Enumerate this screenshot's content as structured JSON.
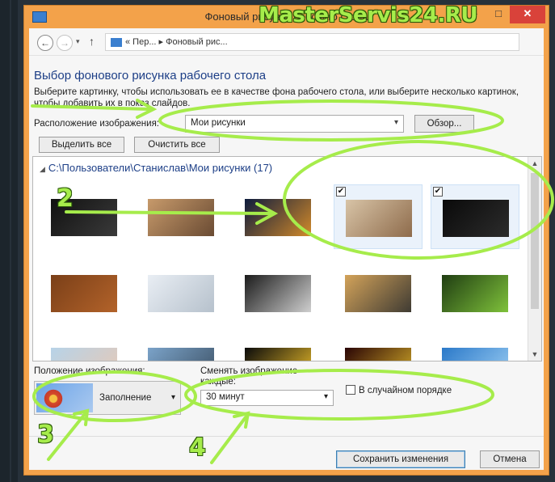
{
  "window": {
    "title": "Фоновый рисунок рабочего стола",
    "minimize_glyph": "–",
    "maximize_glyph": "□",
    "close_glyph": "✕"
  },
  "address": {
    "back_glyph": "←",
    "forward_glyph": "→",
    "up_glyph": "↑",
    "recent_glyph": "▾",
    "breadcrumb": "« Пер... ▸ Фоновый рис...",
    "search_icon": "search-icon"
  },
  "watermark": "MasterServis24.RU",
  "page": {
    "heading": "Выбор фонового рисунка рабочего стола",
    "description": "Выберите картинку, чтобы использовать ее в качестве фона рабочего стола, или выберите несколько картинок, чтобы добавить их в показ слайдов."
  },
  "location": {
    "label": "Расположение изображения:",
    "value": "Мои рисунки",
    "browse": "Обзор..."
  },
  "selection": {
    "select_all": "Выделить все",
    "clear_all": "Очистить все"
  },
  "gallery": {
    "folder": "C:\\Пользователи\\Станислав\\Мои рисунки (17)",
    "thumbs": [
      {
        "name": "dark-texture",
        "colors": [
          "#111",
          "#3a3a3a"
        ],
        "checked": false
      },
      {
        "name": "girl-car-interior",
        "colors": [
          "#c79a6b",
          "#6a4b33"
        ],
        "checked": false
      },
      {
        "name": "night-city",
        "colors": [
          "#0d1b3d",
          "#d28a2a"
        ],
        "checked": false
      },
      {
        "name": "vintage-camera-desk",
        "colors": [
          "#d8c4a7",
          "#8e6b4b"
        ],
        "checked": true
      },
      {
        "name": "dark-floral",
        "colors": [
          "#0a0a0a",
          "#2c2c2c"
        ],
        "checked": true
      },
      {
        "name": "wood-shelves",
        "colors": [
          "#7a3f18",
          "#b3632a"
        ],
        "checked": false
      },
      {
        "name": "white-car-girl",
        "colors": [
          "#e9eef4",
          "#b6c1cc"
        ],
        "checked": false
      },
      {
        "name": "girl-dark",
        "colors": [
          "#1b1b1b",
          "#cfcfcf"
        ],
        "checked": false
      },
      {
        "name": "white-car-sunset",
        "colors": [
          "#d3a35a",
          "#3f3b33"
        ],
        "checked": false
      },
      {
        "name": "green-grass",
        "colors": [
          "#1f3d12",
          "#7fc23b"
        ],
        "checked": false
      },
      {
        "name": "pastel-stripes",
        "colors": [
          "#b7d3e8",
          "#e8c8b4"
        ],
        "checked": false
      },
      {
        "name": "city-skyline",
        "colors": [
          "#7ba3c9",
          "#3b4f62"
        ],
        "checked": false
      },
      {
        "name": "minion-1",
        "colors": [
          "#0b0b0b",
          "#f0c12b"
        ],
        "checked": false
      },
      {
        "name": "minion-2",
        "colors": [
          "#2a0505",
          "#d8b02a"
        ],
        "checked": false
      },
      {
        "name": "city-blue",
        "colors": [
          "#2b79c9",
          "#9fd0f4"
        ],
        "checked": false
      }
    ]
  },
  "position": {
    "label": "Положение изображения:",
    "value": "Заполнение"
  },
  "change": {
    "label": "Сменять изображение каждые:",
    "value": "30 минут"
  },
  "shuffle_label": "В случайном порядке",
  "buttons": {
    "save": "Сохранить изменения",
    "cancel": "Отмена"
  },
  "annotations": {
    "numbers": [
      "2",
      "3",
      "4"
    ],
    "color": "#a6ec4b"
  }
}
